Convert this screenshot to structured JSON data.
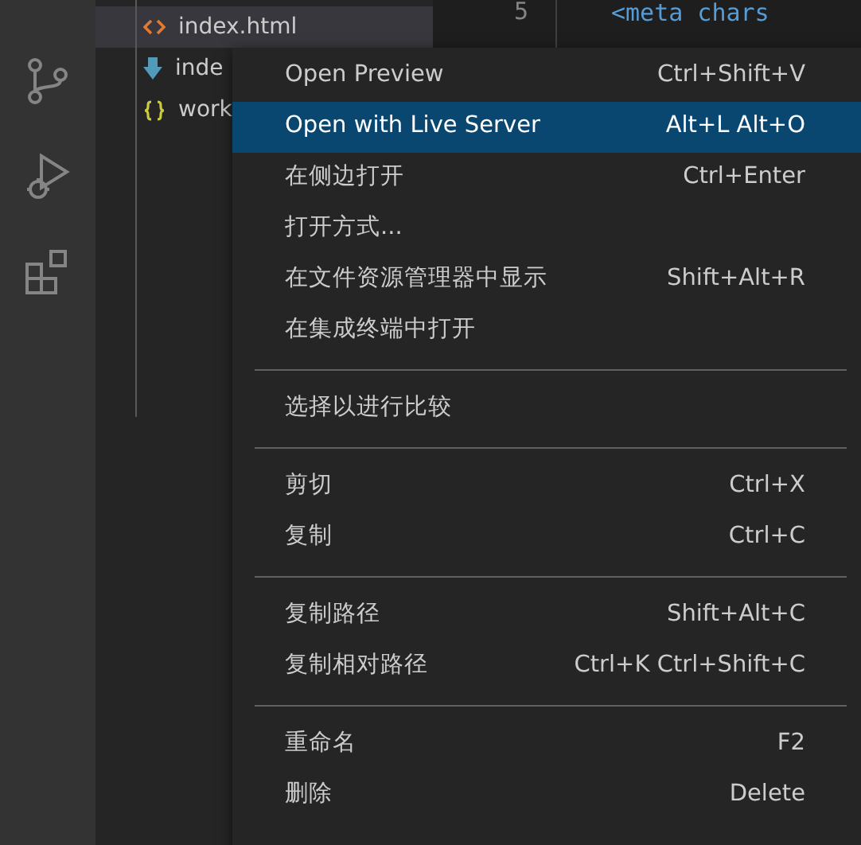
{
  "explorer": {
    "items": [
      {
        "label": "index.html",
        "kind": "html",
        "selected": true
      },
      {
        "label": "inde",
        "kind": "download",
        "selected": false
      },
      {
        "label": "work",
        "kind": "json",
        "selected": false
      }
    ]
  },
  "editor": {
    "line_number": "5",
    "code": "<meta chars"
  },
  "context_menu": {
    "groups": [
      [
        {
          "label": "Open Preview",
          "shortcut": "Ctrl+Shift+V",
          "selected": false
        },
        {
          "label": "Open with Live Server",
          "shortcut": "Alt+L Alt+O",
          "selected": true
        },
        {
          "label": "在侧边打开",
          "shortcut": "Ctrl+Enter",
          "selected": false
        },
        {
          "label": "打开方式...",
          "selected": false
        },
        {
          "label": "在文件资源管理器中显示",
          "shortcut": "Shift+Alt+R",
          "selected": false
        },
        {
          "label": "在集成终端中打开",
          "selected": false
        }
      ],
      [
        {
          "label": "选择以进行比较",
          "selected": false
        }
      ],
      [
        {
          "label": "剪切",
          "shortcut": "Ctrl+X",
          "selected": false
        },
        {
          "label": "复制",
          "shortcut": "Ctrl+C",
          "selected": false
        }
      ],
      [
        {
          "label": "复制路径",
          "shortcut": "Shift+Alt+C",
          "selected": false
        },
        {
          "label": "复制相对路径",
          "shortcut": "Ctrl+K Ctrl+Shift+C",
          "selected": false
        }
      ],
      [
        {
          "label": "重命名",
          "shortcut": "F2",
          "selected": false
        },
        {
          "label": "删除",
          "shortcut": "Delete",
          "selected": false
        }
      ]
    ]
  }
}
